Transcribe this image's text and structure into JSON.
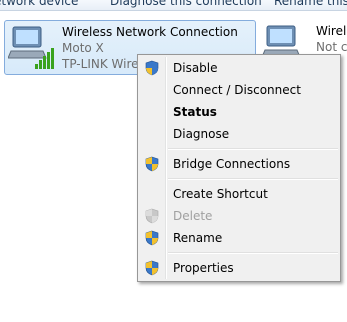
{
  "command_bar": {
    "item1": "etwork device",
    "item2": "Diagnose this connection",
    "item3": "Rename this conn"
  },
  "adapter_selected": {
    "name": "Wireless Network Connection",
    "network": "Moto X",
    "device": "TP-LINK Wirel"
  },
  "adapter_other": {
    "name": "Wirele",
    "status": "Not co"
  },
  "context_menu": {
    "items": [
      {
        "label": "Disable",
        "icon": "shield-icon"
      },
      {
        "label": "Connect / Disconnect"
      },
      {
        "label": "Status",
        "bold": true
      },
      {
        "label": "Diagnose"
      },
      {
        "label": "Bridge Connections",
        "icon": "shield-icon"
      },
      {
        "label": "Create Shortcut"
      },
      {
        "label": "Delete",
        "icon": "shield-icon",
        "disabled": true
      },
      {
        "label": "Rename",
        "icon": "shield-icon"
      },
      {
        "label": "Properties",
        "icon": "shield-icon"
      }
    ]
  },
  "colors": {
    "selection_fill": "#d7eafa",
    "selection_border": "#84acdd",
    "menu_bg": "#f0f0f0",
    "disabled_text": "#a0a0a0"
  }
}
